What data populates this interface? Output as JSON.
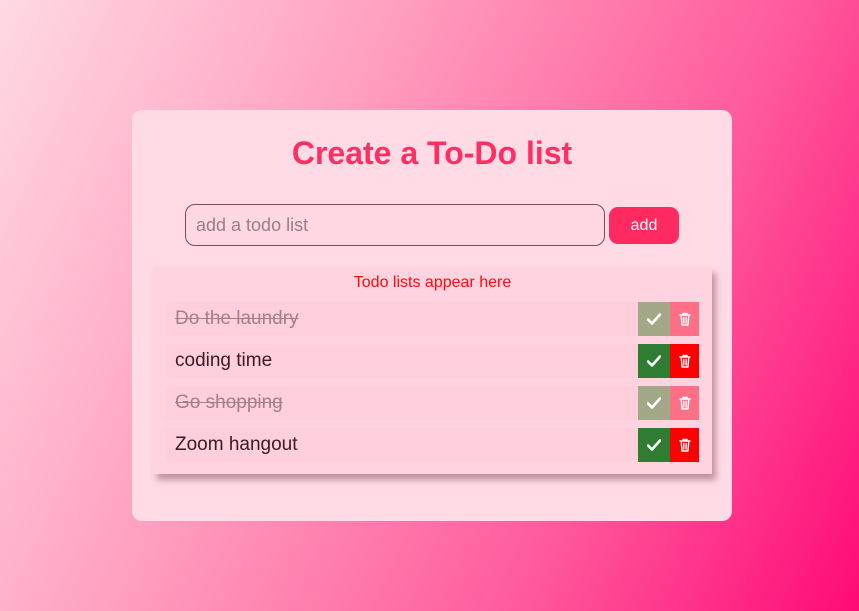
{
  "colors": {
    "title": "#ff2f63",
    "accent": "#ff2b60",
    "header_text": "#ff0a0a",
    "check_active": "#2f7d32",
    "delete_active": "#ff0000"
  },
  "app": {
    "title": "Create a To-Do list"
  },
  "form": {
    "input_value": "",
    "input_placeholder": "add a todo list",
    "add_label": "add"
  },
  "list": {
    "header": "Todo lists appear here",
    "items": [
      {
        "text": "Do the laundry",
        "completed": true
      },
      {
        "text": "coding time",
        "completed": false
      },
      {
        "text": "Go shopping",
        "completed": true
      },
      {
        "text": "Zoom hangout",
        "completed": false
      }
    ]
  },
  "icons": {
    "complete": "check-icon",
    "delete": "trash-icon"
  }
}
